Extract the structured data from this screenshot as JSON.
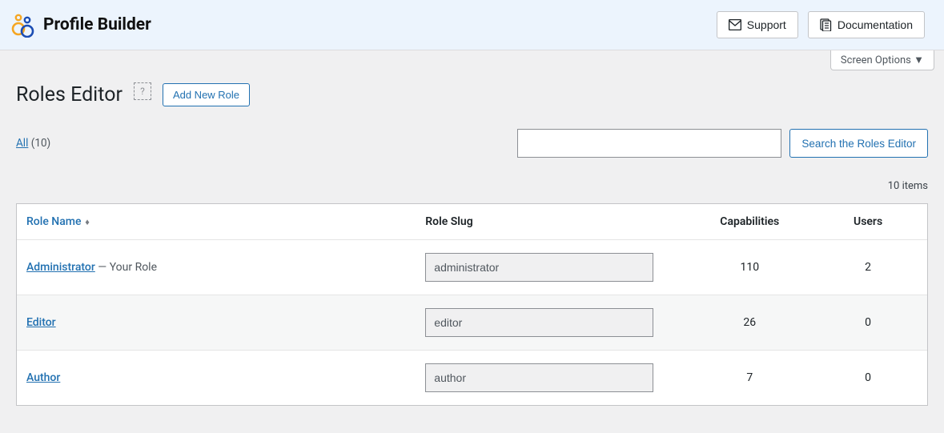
{
  "header": {
    "brand": "Profile Builder",
    "support_label": "Support",
    "docs_label": "Documentation",
    "screen_options_label": "Screen Options"
  },
  "page": {
    "title": "Roles Editor",
    "add_new_label": "Add New Role",
    "help_icon": "?"
  },
  "filter": {
    "all_label": "All",
    "all_count": "(10)",
    "search_button": "Search the Roles Editor",
    "search_value": ""
  },
  "meta": {
    "items_text": "10 items"
  },
  "table": {
    "headers": {
      "name": "Role Name",
      "slug": "Role Slug",
      "caps": "Capabilities",
      "users": "Users"
    },
    "rows": [
      {
        "name": "Administrator",
        "suffix": " — Your Role",
        "slug": "administrator",
        "caps": "110",
        "users": "2"
      },
      {
        "name": "Editor",
        "suffix": "",
        "slug": "editor",
        "caps": "26",
        "users": "0"
      },
      {
        "name": "Author",
        "suffix": "",
        "slug": "author",
        "caps": "7",
        "users": "0"
      }
    ]
  }
}
